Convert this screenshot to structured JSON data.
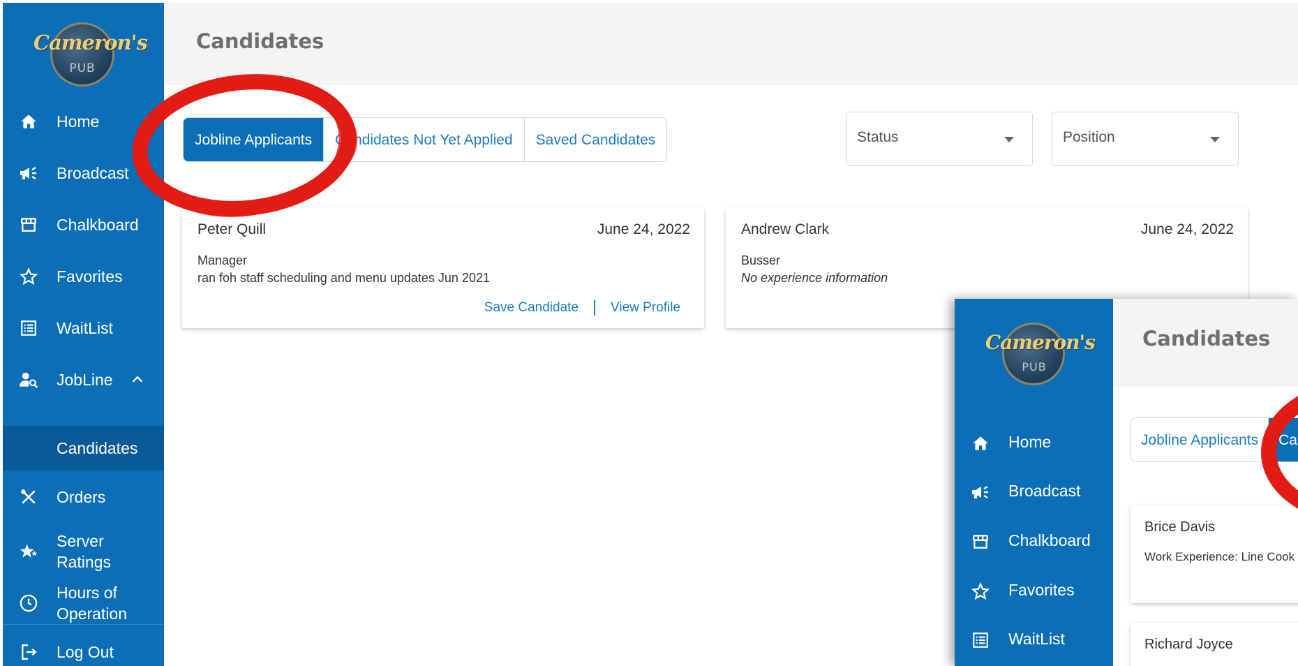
{
  "colors": {
    "sidebar_bg": "#0b6eb7",
    "sidebar_active": "#0a5a98",
    "link": "#1c7cc4",
    "annotation_red": "#e21c14"
  },
  "brand": {
    "logo_script": "Cameron's",
    "logo_sub": "PUB"
  },
  "sidebar": {
    "items": [
      {
        "label": "Home",
        "icon": "home-icon"
      },
      {
        "label": "Broadcast",
        "icon": "megaphone-icon"
      },
      {
        "label": "Chalkboard",
        "icon": "storefront-icon"
      },
      {
        "label": "Favorites",
        "icon": "star-outline-icon"
      },
      {
        "label": "WaitList",
        "icon": "list-icon"
      },
      {
        "label": "JobLine",
        "icon": "person-search-icon",
        "expanded": true
      },
      {
        "label": "Candidates",
        "active": true
      },
      {
        "label": "Orders",
        "icon": "utensils-icon"
      },
      {
        "label": "Server Ratings",
        "icon": "stars-icon"
      },
      {
        "label": "Hours of Operation",
        "icon": "clock-icon"
      },
      {
        "label": "Log Out",
        "icon": "logout-icon"
      }
    ],
    "server_ratings_line1": "Server",
    "server_ratings_line2": "Ratings",
    "hours_line1": "Hours of",
    "hours_line2": "Operation"
  },
  "header": {
    "title": "Candidates"
  },
  "tabs": [
    {
      "label": "Jobline Applicants",
      "active": true
    },
    {
      "label": "Candidates Not Yet Applied",
      "active": false
    },
    {
      "label": "Saved Candidates",
      "active": false
    }
  ],
  "filters": {
    "status": "Status",
    "position": "Position"
  },
  "candidates": [
    {
      "name": "Peter Quill",
      "date": "June 24, 2022",
      "position": "Manager",
      "experience": "ran foh staff scheduling and menu updates  Jun 2021",
      "save_label": "Save Candidate",
      "view_label": "View Profile"
    },
    {
      "name": "Andrew Clark",
      "date": "June 24, 2022",
      "position": "Busser",
      "experience": "No experience information"
    }
  ],
  "inset": {
    "title": "Candidates",
    "nav": [
      "Home",
      "Broadcast",
      "Chalkboard",
      "Favorites",
      "WaitList"
    ],
    "tabs": [
      {
        "label": "Jobline Applicants",
        "active": false
      },
      {
        "label": "Can",
        "active": true
      }
    ],
    "cards": [
      {
        "name": "Brice Davis",
        "work": "Work Experience:  Line Cook"
      },
      {
        "name": "Richard Joyce"
      }
    ]
  }
}
